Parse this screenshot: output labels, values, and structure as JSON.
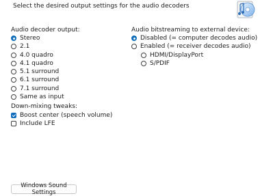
{
  "header": {
    "description": "Select the desired output settings for the audio decoders"
  },
  "decoder": {
    "label": "Audio decoder output:",
    "options": [
      {
        "label": "Stereo",
        "selected": true
      },
      {
        "label": "2.1",
        "selected": false
      },
      {
        "label": "4.0 quadro",
        "selected": false
      },
      {
        "label": "4.1 quadro",
        "selected": false
      },
      {
        "label": "5.1 surround",
        "selected": false
      },
      {
        "label": "6.1 surround",
        "selected": false
      },
      {
        "label": "7.1 surround",
        "selected": false
      },
      {
        "label": "Same as input",
        "selected": false
      }
    ]
  },
  "downmix": {
    "label": "Down-mixing tweaks:",
    "options": [
      {
        "label": "Boost center (speech volume)",
        "checked": true
      },
      {
        "label": "Include LFE",
        "checked": false
      }
    ]
  },
  "bitstream": {
    "label": "Audio bitstreaming to external device:",
    "options": [
      {
        "label": "Disabled (= computer decodes audio)",
        "selected": true
      },
      {
        "label": "Enabled  (= receiver decodes audio)",
        "selected": false
      }
    ],
    "sub_options": [
      {
        "label": "HDMI/DisplayPort",
        "selected": false
      },
      {
        "label": "S/PDIF",
        "selected": false
      }
    ]
  },
  "footer": {
    "sound_settings_label": "Windows Sound Settings"
  },
  "icons": {
    "app": "audio-disc-icon"
  },
  "colors": {
    "accent": "#0f6cbd"
  }
}
